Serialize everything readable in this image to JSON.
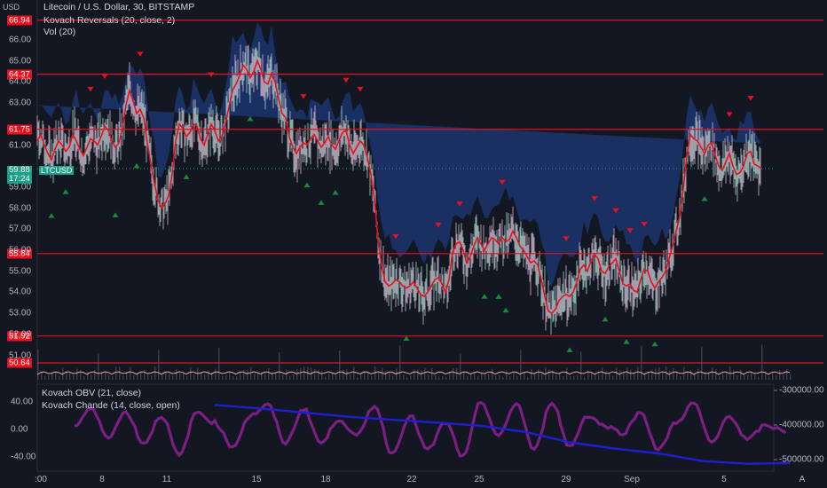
{
  "chart_title": "Litecoin / U.S. Dollar, 30, BITSTAMP",
  "indicators_main": [
    "Kovach Reversals (20, close, 2)",
    "Vol (20)"
  ],
  "indicators_lower": [
    "Kovach OBV (21, close)",
    "Kovach Chande (14, close, open)"
  ],
  "currency_label": "USD",
  "symbol_tag": "LTCUSD",
  "price_tag": "59.88",
  "countdown_tag": "17:24",
  "scale_button": "A",
  "colors": {
    "background": "#131722",
    "level_line": "#e8101e",
    "band": "#1e3a78",
    "mid": "#e8101e",
    "obv": "#1f1fcf",
    "chande": "#7b1f82",
    "up_marker": "#1b8a3a",
    "down_marker": "#e8101e",
    "price_tag": "#1e9e87"
  },
  "chart_data": [
    {
      "type": "line",
      "pane": "price",
      "title": "Litecoin / U.S. Dollar, 30, BITSTAMP",
      "y_ticks": [
        "66.00",
        "65.00",
        "64.00",
        "63.00",
        "61.00",
        "59.00",
        "58.00",
        "57.00",
        "56.00",
        "55.00",
        "54.00",
        "53.00",
        "52.00",
        "51.00"
      ],
      "level_lines": [
        "66.94",
        "64.37",
        "61.75",
        "55.84",
        "51.92",
        "50.64"
      ],
      "x_ticks": [
        ":00",
        "8",
        "11",
        "15",
        "18",
        "22",
        "25",
        "29",
        "Sep",
        "5"
      ],
      "ylim": [
        50.5,
        67.5
      ],
      "x": [
        0,
        4,
        8,
        12,
        16,
        20,
        24,
        28,
        32,
        36,
        40,
        44,
        48,
        52,
        56,
        60,
        64,
        68,
        72,
        76,
        80,
        84,
        88,
        92,
        96,
        100,
        104,
        108,
        112,
        116,
        120,
        124,
        128,
        132,
        136,
        140,
        144,
        148,
        152,
        156,
        160,
        164,
        168,
        172,
        176,
        180,
        184,
        188,
        192,
        196,
        200,
        204,
        208,
        212,
        216,
        220,
        224,
        228,
        232,
        236,
        240,
        244,
        248,
        252,
        256,
        260,
        264,
        268,
        272,
        276,
        280,
        284,
        288,
        292,
        296,
        300,
        304,
        308,
        312,
        316,
        320,
        324,
        328,
        332,
        336,
        340,
        344,
        348,
        352,
        356,
        360,
        364,
        368,
        372,
        376,
        380,
        384,
        388,
        392,
        396,
        400,
        404,
        408,
        412,
        416,
        420,
        424,
        428,
        432,
        436,
        440,
        444,
        448,
        452,
        456,
        460,
        464,
        468,
        472,
        476,
        480,
        484,
        488,
        492,
        496,
        500,
        504,
        508,
        512,
        516,
        520,
        524,
        528,
        532,
        536,
        540,
        544,
        548,
        552,
        556,
        560,
        564,
        568,
        572,
        576,
        580,
        584,
        588,
        592,
        596,
        600,
        604,
        608,
        612,
        616,
        620,
        624,
        628,
        632,
        636,
        640,
        644,
        648,
        652,
        656,
        660,
        664,
        668,
        672,
        676,
        680,
        684,
        688,
        692,
        696,
        700,
        704,
        708,
        712,
        716,
        720,
        724,
        728,
        732,
        736,
        740,
        744,
        748,
        752,
        756,
        760,
        764,
        768,
        772,
        776,
        780,
        784,
        788,
        792,
        796,
        800,
        804,
        808,
        812,
        816,
        820,
        824,
        828,
        832,
        836,
        840,
        844,
        848
      ],
      "series": [
        {
          "values": [
            61.2,
            61.5,
            61.0,
            60.6,
            60.3,
            60.8,
            61.2,
            61.0,
            60.7,
            60.9,
            61.5,
            61.2,
            60.8,
            60.5,
            60.9,
            61.3,
            61.2,
            61.0,
            61.4,
            61.9,
            61.7,
            61.2,
            60.9,
            61.1,
            61.8,
            62.9,
            63.6,
            63.1,
            62.5,
            62.7,
            62.3,
            61.1,
            60.1,
            59.2,
            58.4,
            58.0,
            58.2,
            58.6,
            59.6,
            61.2,
            62.0,
            61.8,
            61.4,
            61.6,
            62.0,
            61.9,
            61.3,
            61.0,
            61.5,
            62.0,
            61.7,
            61.2,
            61.4,
            62.0,
            62.8,
            63.6,
            63.9,
            64.3,
            64.8,
            64.6,
            64.2,
            64.5,
            65.0,
            64.6,
            64.0,
            63.9,
            64.4,
            64.0,
            63.2,
            62.5,
            62.3,
            61.4,
            60.9,
            60.6,
            60.9,
            61.1,
            61.0,
            61.3,
            61.5,
            61.2,
            60.9,
            61.1,
            61.4,
            61.0,
            60.8,
            61.2,
            61.6,
            61.7,
            61.0,
            60.6,
            60.9,
            61.2,
            61.0,
            60.4,
            59.6,
            58.4,
            56.5,
            55.3,
            54.5,
            54.3,
            54.4,
            54.6,
            54.5,
            54.3,
            54.2,
            54.3,
            54.5,
            54.2,
            53.9,
            53.8,
            54.0,
            54.3,
            54.6,
            54.7,
            54.4,
            54.0,
            54.6,
            55.9,
            56.3,
            56.4,
            56.0,
            55.4,
            55.7,
            56.2,
            56.6,
            56.3,
            56.0,
            56.3,
            56.6,
            56.5,
            56.3,
            56.6,
            56.4,
            56.5,
            56.9,
            56.6,
            56.2,
            56.0,
            55.7,
            55.4,
            55.5,
            55.3,
            54.6,
            53.8,
            53.1,
            53.0,
            53.2,
            53.6,
            53.8,
            53.9,
            53.8,
            54.0,
            54.5,
            55.1,
            55.3,
            55.0,
            55.5,
            55.8,
            55.6,
            55.0,
            54.9,
            55.2,
            55.4,
            55.6,
            55.0,
            54.4,
            54.3,
            54.4,
            54.1,
            54.0,
            54.6,
            55.1,
            55.0,
            54.5,
            54.2,
            54.5,
            54.7,
            55.0,
            55.6,
            56.2,
            56.9,
            57.6,
            58.9,
            60.5,
            61.5,
            61.3,
            61.2,
            60.9,
            60.6,
            61.0,
            61.1,
            60.5,
            60.0,
            59.8,
            60.2,
            60.6,
            60.0,
            59.6,
            59.7,
            60.0,
            60.6,
            60.7,
            60.1,
            60.0,
            59.9
          ]
        }
      ]
    },
    {
      "type": "line",
      "pane": "oscillator",
      "left_ticks": [
        "40.00",
        "0.00",
        "-40.00"
      ],
      "right_ticks": [
        "-300000.00",
        "-400000.00",
        "-500000.00"
      ],
      "series": [
        {
          "name": "Kovach OBV (21, close)",
          "x": [
            200,
            250,
            300,
            350,
            400,
            450,
            500,
            550,
            600,
            650,
            700,
            750,
            800,
            848
          ],
          "values": [
            -342000,
            -352000,
            -364000,
            -376000,
            -385000,
            -393000,
            -402000,
            -420000,
            -450000,
            -468000,
            -482000,
            -504000,
            -512000,
            -510000
          ]
        },
        {
          "name": "Kovach Chande (14, close, open)",
          "x": [
            42,
            60,
            80,
            100,
            120,
            140,
            160,
            180,
            200,
            220,
            240,
            260,
            280,
            300,
            320,
            340,
            360,
            380,
            400,
            420,
            440,
            460,
            480,
            500,
            520,
            540,
            560,
            580,
            600,
            620,
            640,
            660,
            680,
            700,
            720,
            740,
            760,
            780,
            800,
            820,
            848
          ],
          "values": [
            5,
            30,
            -10,
            25,
            -20,
            20,
            -38,
            25,
            10,
            -25,
            20,
            35,
            -20,
            30,
            -20,
            15,
            -10,
            35,
            -35,
            20,
            -30,
            10,
            -40,
            40,
            -10,
            38,
            -30,
            40,
            -25,
            20,
            5,
            -5,
            25,
            -30,
            10,
            38,
            -20,
            20,
            -15,
            5,
            -3
          ]
        }
      ]
    }
  ]
}
